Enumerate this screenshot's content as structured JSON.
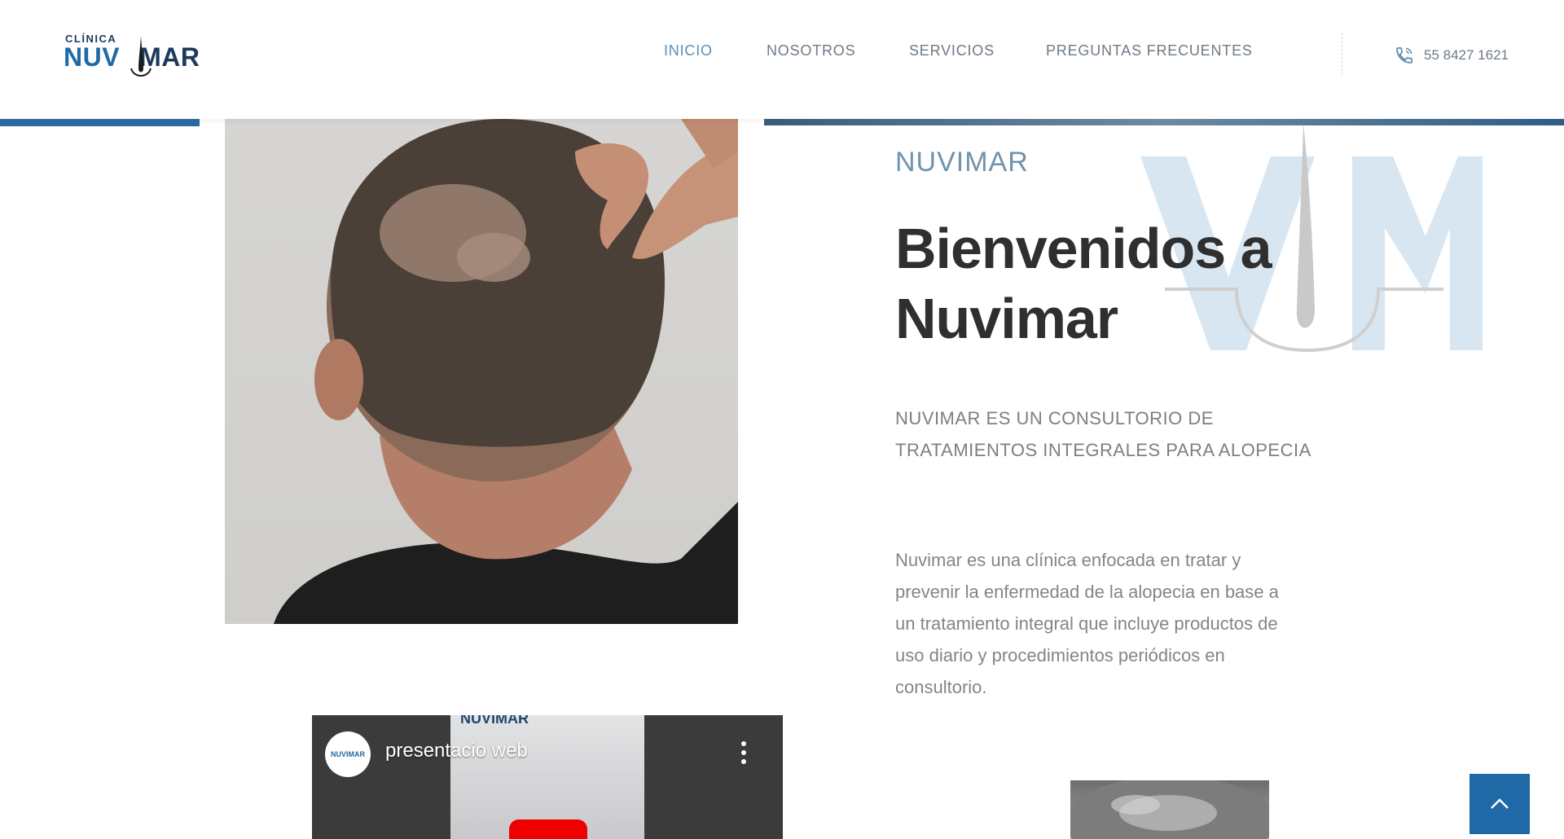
{
  "logo": {
    "small": "CLÍNICA",
    "brand_left": "NUV",
    "brand_right": "MAR"
  },
  "nav": {
    "items": [
      {
        "label": "INICIO",
        "active": true
      },
      {
        "label": "NOSOTROS",
        "active": false
      },
      {
        "label": "SERVICIOS",
        "active": false
      },
      {
        "label": "PREGUNTAS FRECUENTES",
        "active": false
      }
    ],
    "phone": "55 8427 1621",
    "phone_icon": "phone-icon"
  },
  "hero": {
    "brand": "NUVIMAR",
    "title_line1": "Bienvenidos a",
    "title_line2": "Nuvimar",
    "subtitle_line1": "NUVIMAR ES UN CONSULTORIO DE",
    "subtitle_line2": "TRATAMIENTOS INTEGRALES PARA ALOPECIA",
    "description_lines": [
      "Nuvimar es una clínica enfocada en tratar y",
      "prevenir la enfermedad de la alopecia en base a",
      "un tratamiento integral que incluye productos de",
      "uso diario y procedimientos periódicos en",
      "consultorio."
    ]
  },
  "video": {
    "title": "presentacio web",
    "channel_logo": "NUVIMAR",
    "top_logo": "NUVIMAR"
  },
  "scroll_top": {
    "icon": "chevron-up-icon"
  },
  "colors": {
    "accent": "#1f6aa6",
    "nav_active": "#5d8fb4",
    "nav_text": "#6e7a86",
    "title": "#2f2f2f"
  }
}
